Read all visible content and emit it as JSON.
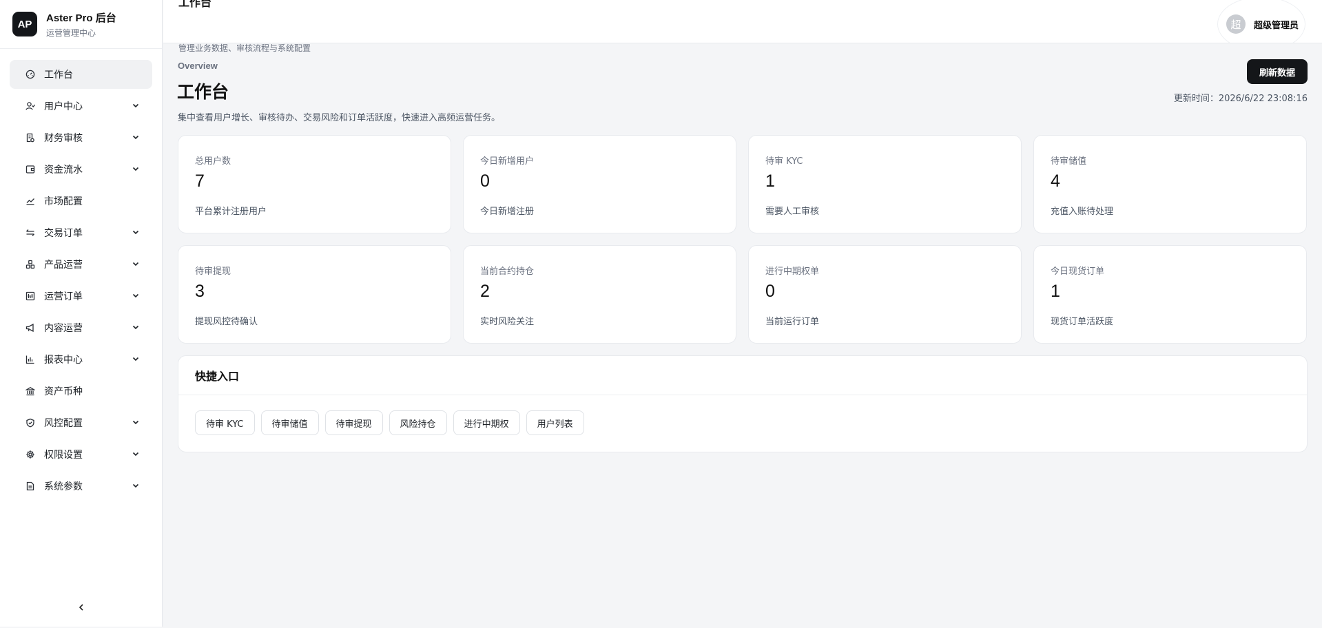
{
  "brand": {
    "logo": "AP",
    "title": "Aster Pro 后台",
    "subtitle": "运营管理中心"
  },
  "sidebar": {
    "items": [
      {
        "label": "工作台",
        "icon": "dashboard-icon",
        "expandable": false,
        "active": true
      },
      {
        "label": "用户中心",
        "icon": "users-icon",
        "expandable": true
      },
      {
        "label": "财务审核",
        "icon": "receipt-icon",
        "expandable": true
      },
      {
        "label": "资金流水",
        "icon": "wallet-icon",
        "expandable": true
      },
      {
        "label": "市场配置",
        "icon": "trend-icon",
        "expandable": false
      },
      {
        "label": "交易订单",
        "icon": "swap-icon",
        "expandable": true
      },
      {
        "label": "产品运营",
        "icon": "boxes-icon",
        "expandable": true
      },
      {
        "label": "运营订单",
        "icon": "ledger-icon",
        "expandable": true
      },
      {
        "label": "内容运营",
        "icon": "megaphone-icon",
        "expandable": true
      },
      {
        "label": "报表中心",
        "icon": "bar-chart-icon",
        "expandable": true
      },
      {
        "label": "资产币种",
        "icon": "bank-icon",
        "expandable": false
      },
      {
        "label": "风控配置",
        "icon": "shield-icon",
        "expandable": true
      },
      {
        "label": "权限设置",
        "icon": "gear-icon",
        "expandable": true
      },
      {
        "label": "系统参数",
        "icon": "document-icon",
        "expandable": true
      }
    ],
    "collapse_icon": "chevron-left-icon"
  },
  "header": {
    "title": "工作台",
    "subtitle": "管理业务数据、审核流程与系统配置",
    "user": {
      "avatar_text": "超",
      "name": "超级管理员"
    }
  },
  "main": {
    "overview_label": "Overview",
    "title": "工作台",
    "description": "集中查看用户增长、审核待办、交易风险和订单活跃度，快速进入高频运营任务。",
    "refresh_label": "刷新数据",
    "update_time": "更新时间：2026/6/22 23:08:16",
    "cards": [
      {
        "title": "总用户数",
        "value": "7",
        "desc": "平台累计注册用户"
      },
      {
        "title": "今日新增用户",
        "value": "0",
        "desc": "今日新增注册"
      },
      {
        "title": "待审 KYC",
        "value": "1",
        "desc": "需要人工审核"
      },
      {
        "title": "待审储值",
        "value": "4",
        "desc": "充值入账待处理"
      },
      {
        "title": "待审提现",
        "value": "3",
        "desc": "提现风控待确认"
      },
      {
        "title": "当前合约持仓",
        "value": "2",
        "desc": "实时风险关注"
      },
      {
        "title": "进行中期权单",
        "value": "0",
        "desc": "当前运行订单"
      },
      {
        "title": "今日现货订单",
        "value": "1",
        "desc": "现货订单活跃度"
      }
    ],
    "quick": {
      "title": "快捷入口",
      "links": [
        "待审 KYC",
        "待审储值",
        "待审提现",
        "风险持仓",
        "进行中期权",
        "用户列表"
      ]
    }
  }
}
